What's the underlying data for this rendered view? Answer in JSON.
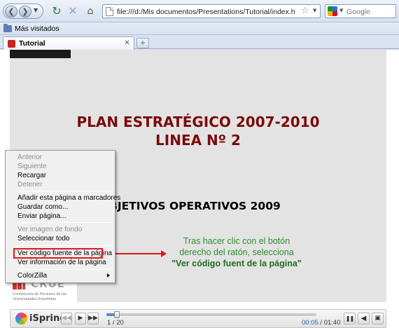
{
  "browser": {
    "url": "file:///d:/Mis documentos/Presentations/Tutorial/index.html",
    "search_placeholder": "Google",
    "icons": {
      "back": "back-arrow-icon",
      "forward": "forward-arrow-icon",
      "reload": "reload-icon",
      "stop": "stop-icon",
      "home": "home-icon",
      "bookmark_star": "star-icon"
    }
  },
  "bookmarks_bar": {
    "items": [
      {
        "label": "Más visitados"
      }
    ]
  },
  "tabs": [
    {
      "title": "Tutorial"
    }
  ],
  "slide": {
    "title_line1": "PLAN ESTRATÉGICO 2007-2010",
    "title_line2": "LINEA Nº 2",
    "subtitle": "BJETIVOS OPERATIVOS 2009",
    "hint_line1": "Tras hacer clic con el botón",
    "hint_line2": "derecho del ratón, selecciona",
    "hint_line3": "\"Ver código fuent de la página\"",
    "crue_name": "CRUE",
    "crue_sub": "Conferencia de Rectores de las Universidades Españolas"
  },
  "context_menu": {
    "items": [
      {
        "label": "Anterior",
        "disabled": true
      },
      {
        "label": "Siguiente",
        "disabled": true
      },
      {
        "label": "Recargar",
        "disabled": false
      },
      {
        "label": "Detener",
        "disabled": true
      },
      {
        "label": "Añadir esta página a marcadores",
        "disabled": false
      },
      {
        "label": "Guardar como...",
        "disabled": false
      },
      {
        "label": "Enviar página...",
        "disabled": false
      },
      {
        "label": "Ver imagen de fondo",
        "disabled": true
      },
      {
        "label": "Seleccionar todo",
        "disabled": false
      },
      {
        "label": "Ver código fuente de la página",
        "disabled": false,
        "highlighted": true
      },
      {
        "label": "Ver información de la página",
        "disabled": false
      },
      {
        "label": "ColorZilla",
        "disabled": false,
        "submenu": true
      }
    ]
  },
  "player": {
    "brand": "iSpring",
    "slide_indicator": "1 / 20",
    "time_current": "00:05",
    "time_total": "01:40",
    "progress": 0.05,
    "colors": {
      "accent": "#4d8fd6",
      "title": "#7a0b0b",
      "hint": "#2f8d2f",
      "highlight": "#e0161d"
    }
  }
}
